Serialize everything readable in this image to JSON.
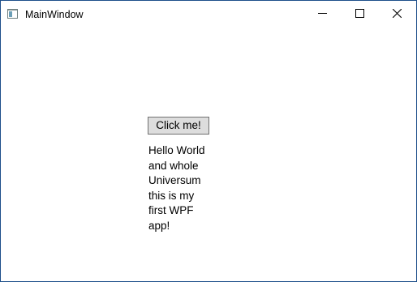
{
  "window": {
    "title": "MainWindow",
    "controls": {
      "minimize_icon": "minimize-icon",
      "maximize_icon": "maximize-icon",
      "close_icon": "close-icon"
    },
    "border_color": "#1e4f8a"
  },
  "content": {
    "button_label": "Click me!",
    "message": "Hello World and whole Universum this is my first WPF app!"
  }
}
